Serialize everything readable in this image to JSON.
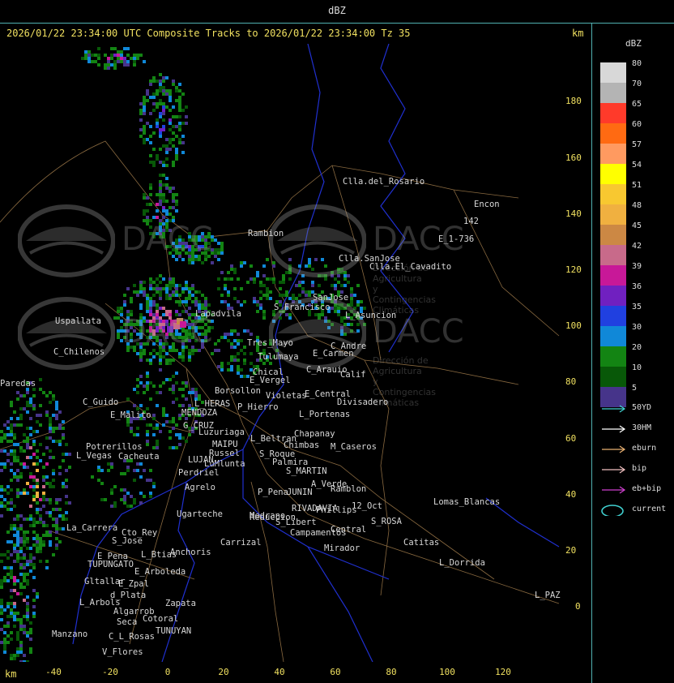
{
  "window": {
    "title": "dBZ"
  },
  "header": {
    "text": "2026/01/22 23:34:00 UTC Composite Tracks to 2026/01/22 23:34:00 Tz 35",
    "km_top": "km",
    "km_bottom": "km"
  },
  "axes": {
    "y_ticks": [
      "180",
      "160",
      "140",
      "120",
      "100",
      "80",
      "60",
      "40",
      "20",
      "0"
    ],
    "x_ticks": [
      "-40",
      "-20",
      "0",
      "20",
      "40",
      "60",
      "80",
      "100",
      "120"
    ]
  },
  "legend": {
    "title": "dBZ",
    "scale": [
      {
        "value": "80",
        "color": "#d8d8d8"
      },
      {
        "value": "70",
        "color": "#b4b4b4"
      },
      {
        "value": "65",
        "color": "#ff3a2a"
      },
      {
        "value": "60",
        "color": "#ff6a12"
      },
      {
        "value": "57",
        "color": "#ff9a60"
      },
      {
        "value": "54",
        "color": "#ffff00"
      },
      {
        "value": "51",
        "color": "#f8c830"
      },
      {
        "value": "48",
        "color": "#f0b040"
      },
      {
        "value": "45",
        "color": "#cc8844"
      },
      {
        "value": "42",
        "color": "#c86a8a"
      },
      {
        "value": "39",
        "color": "#c81898"
      },
      {
        "value": "36",
        "color": "#7020c0"
      },
      {
        "value": "35",
        "color": "#2040e0"
      },
      {
        "value": "30",
        "color": "#1088d8"
      },
      {
        "value": "20",
        "color": "#138413"
      },
      {
        "value": "10",
        "color": "#085808"
      },
      {
        "value": "5",
        "color": "#46348a"
      }
    ],
    "tracks": [
      {
        "label": "50YD",
        "color": "#40d0d0"
      },
      {
        "label": "30HM",
        "color": "#ffffff"
      },
      {
        "label": "eburn",
        "color": "#e8b070"
      },
      {
        "label": "bip",
        "color": "#f0c0c0"
      },
      {
        "label": "eb+bip",
        "color": "#d040d0"
      }
    ],
    "current_label": "current",
    "current_color": "#40d0d0"
  },
  "watermark": {
    "brand": "DACC",
    "line1": "Dirección de Agricultura",
    "line2": "y Contingencias Climáticas"
  },
  "places": [
    "Clla.del_Rosario",
    "Encon",
    "E_1-736",
    "142",
    "Rambion",
    "Clla.SanJose",
    "Clla.El_Cavadito",
    "SanJose",
    "S_Francisco",
    "L_Asuncion",
    "Lapadvila",
    "Uspallata",
    "Tres_Mayo",
    "C_Andre",
    "Tulumaya",
    "E_Carmen",
    "C_Chilenos",
    "C_Arauio",
    "Calif",
    "Chical",
    "E_Vergel",
    "Borsollon",
    "Violetas",
    "E_Central",
    "Divisadero",
    "Paredas",
    "C_Guido",
    "L_HERAS",
    "P_Hierro",
    "E_Malito",
    "MENDOZA",
    "G_CRUZ",
    "L_Portenas",
    "Luzuriaga",
    "Chapanay",
    "L_Beltran",
    "Chimbas",
    "M_Caseros",
    "MAIPU",
    "Potrerillos",
    "Russel",
    "S_Roque",
    "L_Vegas",
    "Cacheuta",
    "LUJAN",
    "LuMlunta",
    "Palmira",
    "Perdriel",
    "S_MARTIN",
    "A_Verde",
    "Agrelo",
    "Ramblon",
    "P_Pena",
    "JUNIN",
    "Ugarteche",
    "RIVADAVIA",
    "Phillips",
    "12_Oct",
    "Lomas_Blancas",
    "Medrano",
    "Reduccion",
    "S_Libert",
    "S_ROSA",
    "La_Carrera",
    "Cto_Rey",
    "S_Jose",
    "Campamentos",
    "Central",
    "Catitas",
    "Carrizal",
    "E_Pena",
    "L_Btias",
    "Anchoris",
    "Mirador",
    "TUPUNGATO",
    "L_Dorrida",
    "E_Arboleda",
    "Gltallar",
    "E_Zpal",
    "d_Plata",
    "L_Arbols",
    "Zapata",
    "Algarrob",
    "Cotoral",
    "Seca",
    "TUNUYAN",
    "Manzano",
    "C_L_Rosas",
    "V_Flores",
    "L_PAZ"
  ]
}
